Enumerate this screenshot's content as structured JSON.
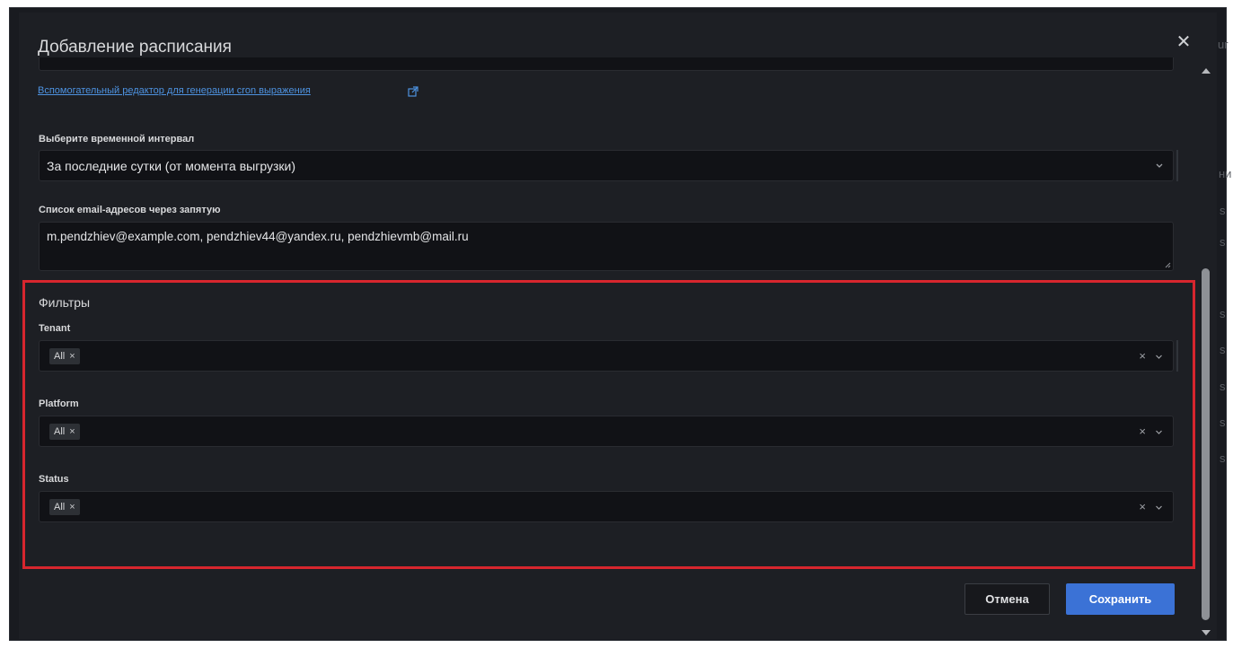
{
  "background": {
    "ghost_letters": [
      "ur",
      "ни",
      "s",
      "s",
      "s",
      "s",
      "s",
      "s",
      "s"
    ]
  },
  "modal": {
    "title": "Добавление расписания",
    "close_glyph": "✕"
  },
  "cron_helper": {
    "link_text": "Вспомогательный редактор для генерации cron выражения",
    "icon": "external-link-icon"
  },
  "interval": {
    "label": "Выберите временной интервал",
    "value": "За последние сутки (от момента выгрузки)"
  },
  "emails": {
    "label": "Список email-адресов через запятую",
    "value": "m.pendzhiev@example.com, pendzhiev44@yandex.ru, pendzhievmb@mail.ru"
  },
  "filters": {
    "title": "Фильтры",
    "items": [
      {
        "label": "Tenant",
        "chip": "All",
        "chip_remove": "×",
        "clear": "×"
      },
      {
        "label": "Platform",
        "chip": "All",
        "chip_remove": "×",
        "clear": "×"
      },
      {
        "label": "Status",
        "chip": "All",
        "chip_remove": "×",
        "clear": "×"
      }
    ],
    "highlight_color": "#d7262e"
  },
  "actions": {
    "cancel": "Отмена",
    "save": "Сохранить"
  },
  "colors": {
    "modal_bg": "#1d1f24",
    "field_bg": "#111216",
    "accent": "#3b72d6",
    "link": "#4d92e0"
  }
}
